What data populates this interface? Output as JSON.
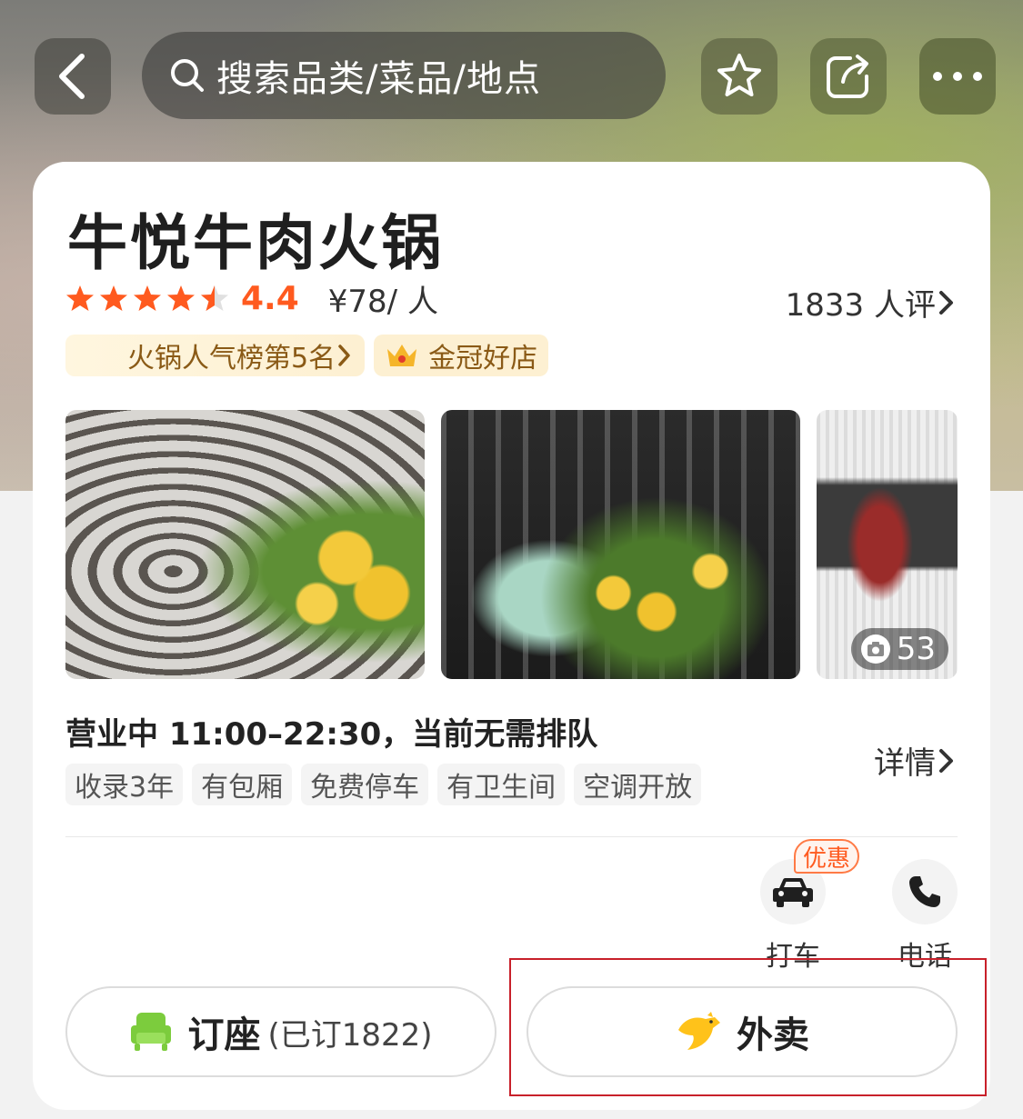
{
  "header": {
    "search_placeholder": "搜索品类/菜品/地点"
  },
  "shop": {
    "name": "牛悦牛肉火锅",
    "rating": "4.4",
    "rating_value": 4.4,
    "price": "¥78/ 人",
    "reviews": "1833 人评",
    "badges": {
      "rank": "火锅人气榜第5名",
      "crown": "金冠好店"
    },
    "photo_count": "53",
    "hours": "营业中 11:00–22:30，当前无需排队",
    "detail_label": "详情",
    "tags": [
      "收录3年",
      "有包厢",
      "免费停车",
      "有卫生间",
      "空调开放"
    ]
  },
  "actions": {
    "taxi": "打车",
    "taxi_promo": "优惠",
    "phone": "电话"
  },
  "buttons": {
    "seat_label": "订座",
    "seat_sub": "(已订1822)",
    "takeout_label": "外卖"
  },
  "colors": {
    "accent": "#ff5a1f",
    "badge_text": "#8a5a16",
    "seat_icon": "#7ccc3d",
    "takeout_icon": "#ffc21a",
    "highlight": "#c8202a"
  },
  "icons": [
    "back-icon",
    "search-icon",
    "star-icon",
    "share-icon",
    "more-icon",
    "crown-icon",
    "camera-icon",
    "car-icon",
    "phone-icon",
    "sofa-icon",
    "kangaroo-icon",
    "chevron-right-icon"
  ]
}
